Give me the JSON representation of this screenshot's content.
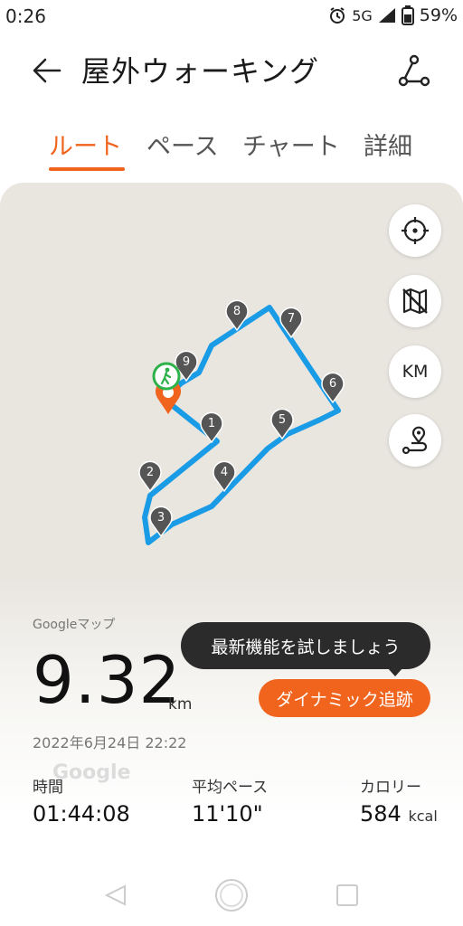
{
  "status_bar": {
    "time": "0:26",
    "network": "5G",
    "battery": "59%"
  },
  "header": {
    "title": "屋外ウォーキング",
    "back_icon": "arrow-left-icon",
    "share_icon": "route-share-icon"
  },
  "tabs": [
    {
      "label": "ルート",
      "active": true
    },
    {
      "label": "ペース",
      "active": false
    },
    {
      "label": "チャート",
      "active": false
    },
    {
      "label": "詳細",
      "active": false
    }
  ],
  "map": {
    "source_label": "Googleマップ",
    "watermark": "Google",
    "controls": {
      "locate_icon": "crosshair-icon",
      "map_style_icon": "map-off-icon",
      "unit_label": "KM",
      "route_icon": "route-pin-icon"
    },
    "markers": [
      "1",
      "2",
      "3",
      "4",
      "5",
      "6",
      "7",
      "8",
      "9"
    ],
    "colors": {
      "route": "#1a9be6",
      "marker": "#555555",
      "start": "#2db24a",
      "end": "#f0641e"
    }
  },
  "tooltip": "最新機能を試しましょう",
  "dynamic_button": "ダイナミック追跡",
  "summary": {
    "distance": "9.32",
    "distance_unit": "km",
    "date": "2022年6月24日 22:22",
    "stats": [
      {
        "label": "時間",
        "value": "01:44:08",
        "unit": ""
      },
      {
        "label": "平均ペース",
        "value": "11'10\"",
        "unit": ""
      },
      {
        "label": "カロリー",
        "value": "584",
        "unit": "kcal"
      }
    ]
  },
  "accent_color": "#f0641e"
}
